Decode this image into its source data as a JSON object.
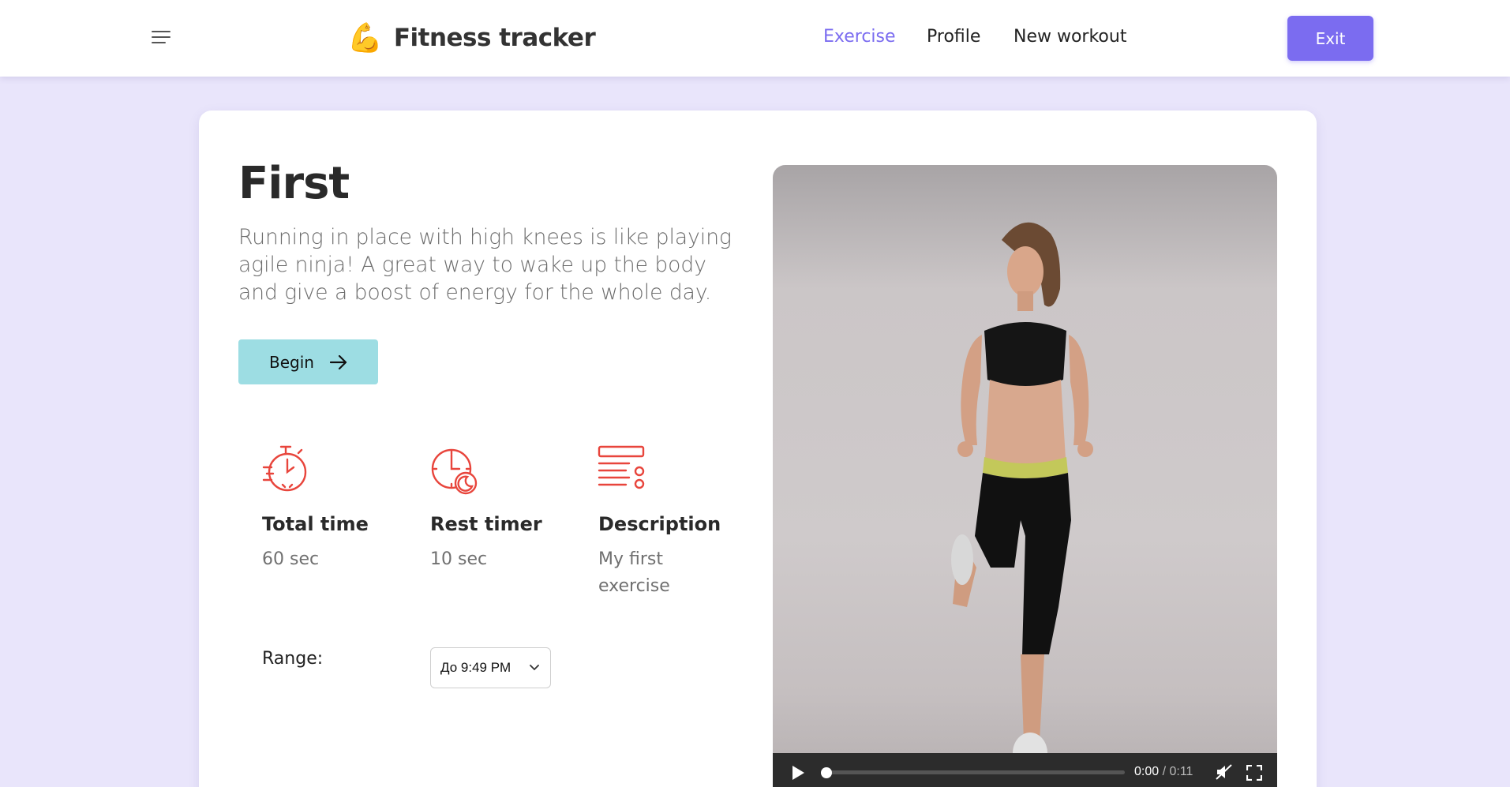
{
  "app": {
    "brand_icon": "💪",
    "brand_name": "Fitness tracker",
    "accent_color": "#7b6cf0"
  },
  "nav": {
    "items": [
      {
        "label": "Exercise",
        "active": true
      },
      {
        "label": "Profile",
        "active": false
      },
      {
        "label": "New workout",
        "active": false
      }
    ],
    "exit_label": "Exit"
  },
  "exercise": {
    "title": "First",
    "description": "Running in place with high knees is like playing agile ninja! A great way to wake up the body and give a boost of energy for the whole day.",
    "begin_label": "Begin",
    "stats": [
      {
        "icon": "stopwatch-icon",
        "label": "Total time",
        "value": "60 sec"
      },
      {
        "icon": "clock-moon-icon",
        "label": "Rest timer",
        "value": "10 sec"
      },
      {
        "icon": "list-icon",
        "label": "Description",
        "value": "My first exercise"
      }
    ],
    "range_label": "Range:",
    "range_selected": "До 9:49 PM"
  },
  "video": {
    "current_time": "0:00",
    "separator": "/",
    "duration": "0:11",
    "progress": 0,
    "muted": true
  }
}
